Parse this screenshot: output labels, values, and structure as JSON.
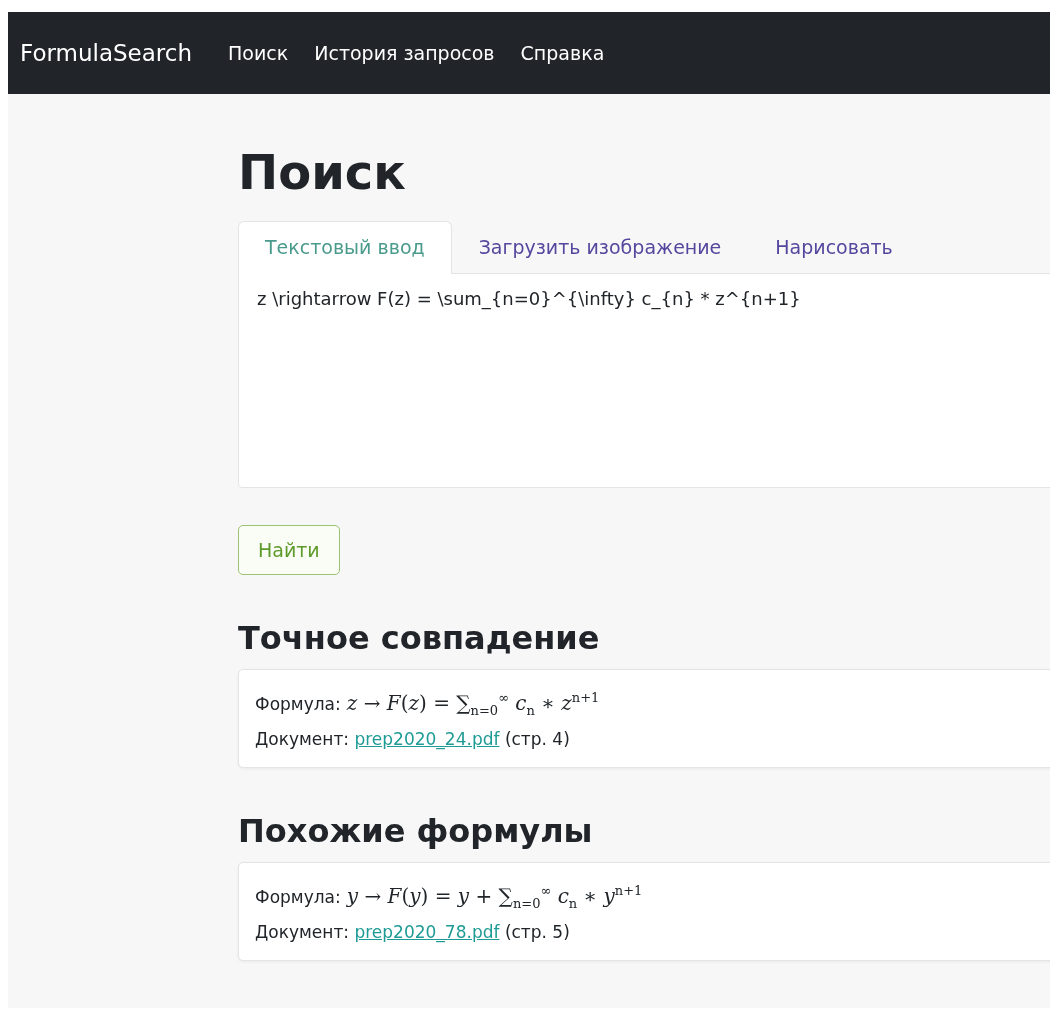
{
  "navbar": {
    "brand": "FormulaSearch",
    "links": [
      {
        "label": "Поиск"
      },
      {
        "label": "История запросов"
      },
      {
        "label": "Справка"
      }
    ]
  },
  "page_title": "Поиск",
  "tabs": [
    {
      "label": "Текстовый ввод",
      "selected": true
    },
    {
      "label": "Загрузить изображение",
      "selected": false
    },
    {
      "label": "Нарисовать",
      "selected": false
    }
  ],
  "query": {
    "value": "z \\rightarrow F(z) = \\sum_{n=0}^{\\infty} c_{n} * z^{n+1}"
  },
  "search_button": "Найти",
  "sections": [
    {
      "title": "Точное совпадение",
      "results": [
        {
          "formula_label": "Формула:",
          "formula": "*z* → *F*(*z*) = ∑$_{n=0}$$^{∞}$ *c*$_{n}$ ∗ *z*$^{n+1}$",
          "document_label": "Документ:",
          "document": "prep2020_24.pdf",
          "page": "(стр. 4)"
        }
      ]
    },
    {
      "title": "Похожие формулы",
      "results": [
        {
          "formula_label": "Формула:",
          "formula": "*y* → *F*(*y*) = *y* + ∑$_{n=0}$$^{∞}$ *c*$_{n}$ ∗ *y*$^{n+1}$",
          "document_label": "Документ:",
          "document": "prep2020_78.pdf",
          "page": "(стр. 5)"
        }
      ]
    }
  ]
}
